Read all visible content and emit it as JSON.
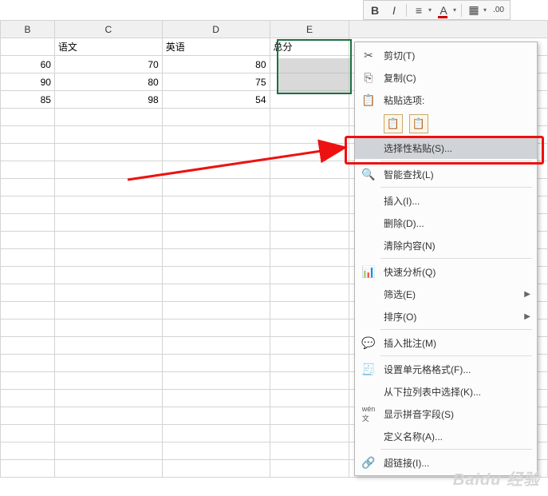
{
  "toolbar": {
    "bold": "B",
    "italic": "I",
    "align": "≡",
    "font": "A"
  },
  "columns": {
    "b": "B",
    "c": "C",
    "d": "D",
    "e": "E"
  },
  "headers": {
    "chinese": "语文",
    "english": "英语",
    "total": "总分"
  },
  "rows": [
    {
      "b": "60",
      "c": "70",
      "d": "80"
    },
    {
      "b": "90",
      "c": "80",
      "d": "75"
    },
    {
      "b": "85",
      "c": "98",
      "d": "54"
    }
  ],
  "menu": {
    "cut": "剪切(T)",
    "copy": "复制(C)",
    "paste_options": "粘贴选项:",
    "paste_special": "选择性粘贴(S)...",
    "smart_lookup": "智能查找(L)",
    "insert": "插入(I)...",
    "delete": "删除(D)...",
    "clear": "清除内容(N)",
    "quick_analysis": "快速分析(Q)",
    "filter": "筛选(E)",
    "sort": "排序(O)",
    "insert_comment": "插入批注(M)",
    "format_cells": "设置单元格格式(F)...",
    "dropdown_pick": "从下拉列表中选择(K)...",
    "show_pinyin": "显示拼音字段(S)",
    "define_name": "定义名称(A)...",
    "hyperlink": "超链接(I)..."
  },
  "watermark": "Baidu 经验"
}
